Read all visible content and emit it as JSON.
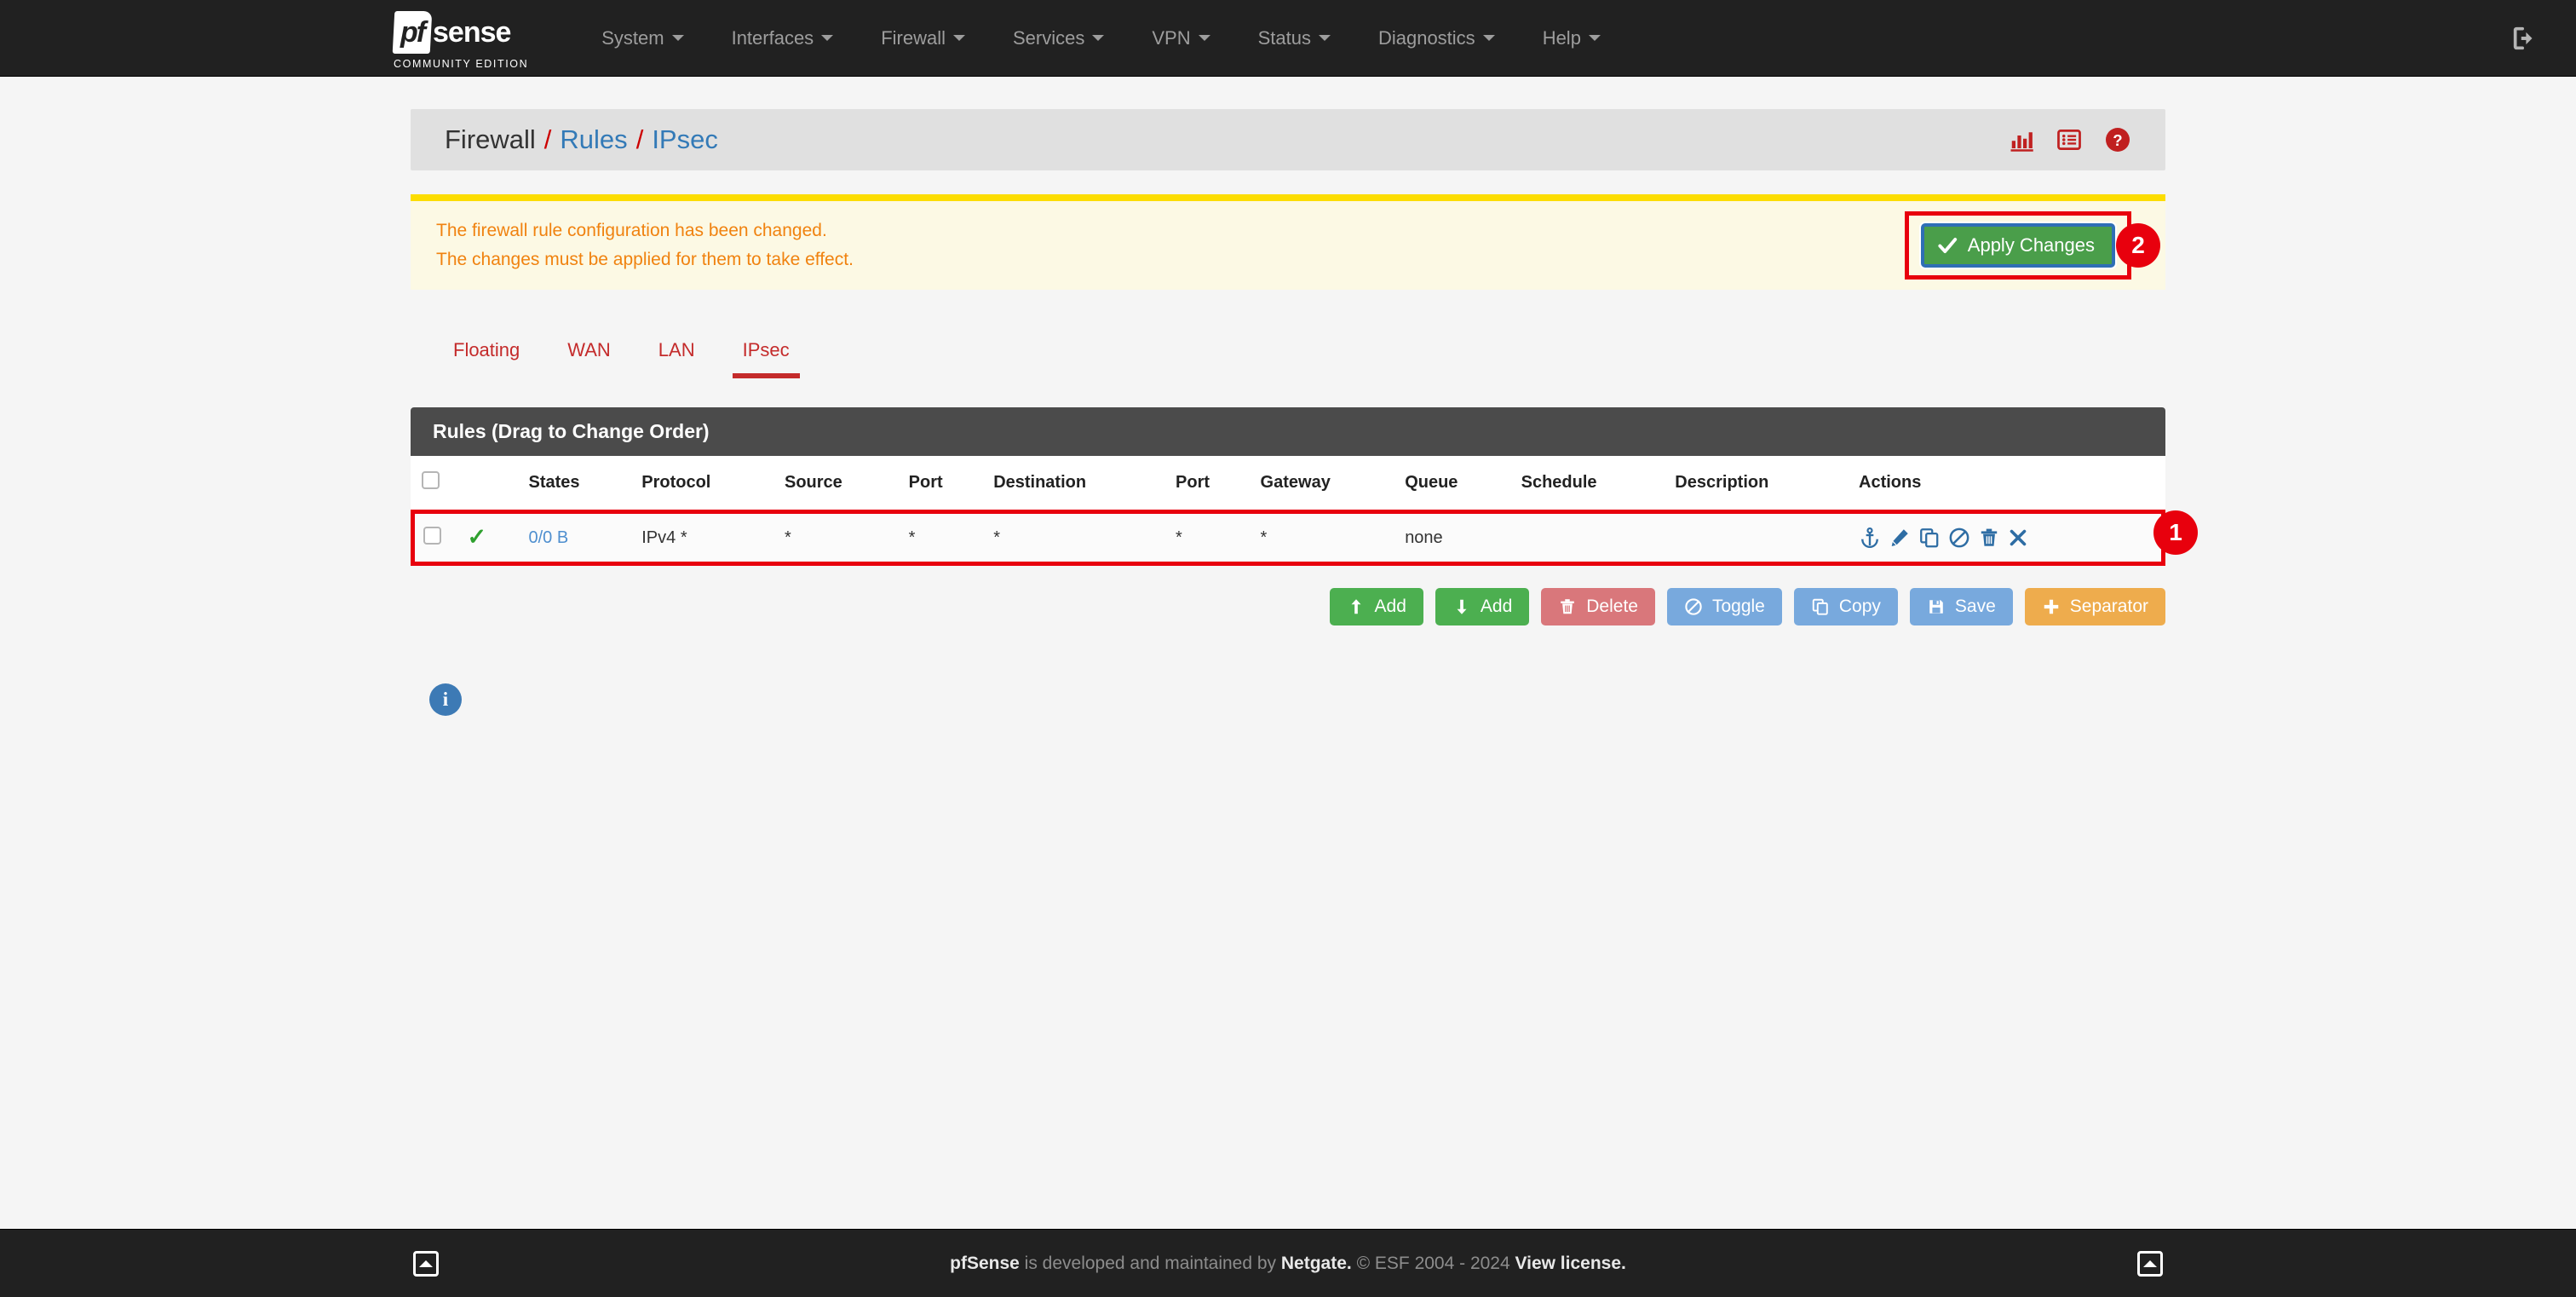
{
  "navbar": {
    "brand_mark": "pf",
    "brand_word": "sense",
    "brand_sub": "COMMUNITY EDITION",
    "items": [
      {
        "label": "System"
      },
      {
        "label": "Interfaces"
      },
      {
        "label": "Firewall"
      },
      {
        "label": "Services"
      },
      {
        "label": "VPN"
      },
      {
        "label": "Status"
      },
      {
        "label": "Diagnostics"
      },
      {
        "label": "Help"
      }
    ],
    "logout_icon": "logout-icon"
  },
  "header": {
    "breadcrumb": {
      "root": "Firewall",
      "sep": "/",
      "level2": "Rules",
      "level3": "IPsec"
    },
    "icons": [
      {
        "name": "chart-icon"
      },
      {
        "name": "log-icon"
      },
      {
        "name": "help-icon"
      }
    ]
  },
  "alert": {
    "line1": "The firewall rule configuration has been changed.",
    "line2": "The changes must be applied for them to take effect.",
    "apply_label": "Apply Changes",
    "badge": "2"
  },
  "tabs": [
    {
      "label": "Floating",
      "active": false
    },
    {
      "label": "WAN",
      "active": false
    },
    {
      "label": "LAN",
      "active": false
    },
    {
      "label": "IPsec",
      "active": true
    }
  ],
  "panel": {
    "title": "Rules (Drag to Change Order)",
    "columns": [
      "",
      "States",
      "Protocol",
      "Source",
      "Port",
      "Destination",
      "Port",
      "Gateway",
      "Queue",
      "Schedule",
      "Description",
      "Actions"
    ],
    "rows": [
      {
        "selected": false,
        "status_icon": "pass-check-icon",
        "states": "0/0 B",
        "protocol": "IPv4 *",
        "source": "*",
        "src_port": "*",
        "destination": "*",
        "dst_port": "*",
        "gateway": "*",
        "queue": "none",
        "schedule": "",
        "description": "",
        "actions": [
          "anchor-icon",
          "edit-icon",
          "copy-icon",
          "disable-icon",
          "delete-icon",
          "close-icon"
        ]
      }
    ],
    "row_badge": "1"
  },
  "buttons": [
    {
      "label": "Add",
      "icon": "arrow-up-icon",
      "style": "green"
    },
    {
      "label": "Add",
      "icon": "arrow-down-icon",
      "style": "green"
    },
    {
      "label": "Delete",
      "icon": "trash-icon",
      "style": "red"
    },
    {
      "label": "Toggle",
      "icon": "ban-icon",
      "style": "blue"
    },
    {
      "label": "Copy",
      "icon": "copy-icon",
      "style": "blue"
    },
    {
      "label": "Save",
      "icon": "save-icon",
      "style": "blue"
    },
    {
      "label": "Separator",
      "icon": "plus-icon",
      "style": "orange"
    }
  ],
  "info": {
    "icon": "info-icon"
  },
  "footer": {
    "brand": "pfSense",
    "mid": " is developed and maintained by ",
    "netgate": "Netgate.",
    "copyright": " © ESF 2004 - 2024 ",
    "license": "View license."
  },
  "colors": {
    "navbar_bg": "#212121",
    "accent_red": "#c42b2b",
    "link_blue": "#337ab7",
    "alert_bg": "#fcf9e4",
    "alert_border": "#fcdd00",
    "alert_text": "#f0820f",
    "apply_green": "#4a9e4a",
    "annotation_red": "#e8000d",
    "panel_head": "#4b4b4b"
  }
}
